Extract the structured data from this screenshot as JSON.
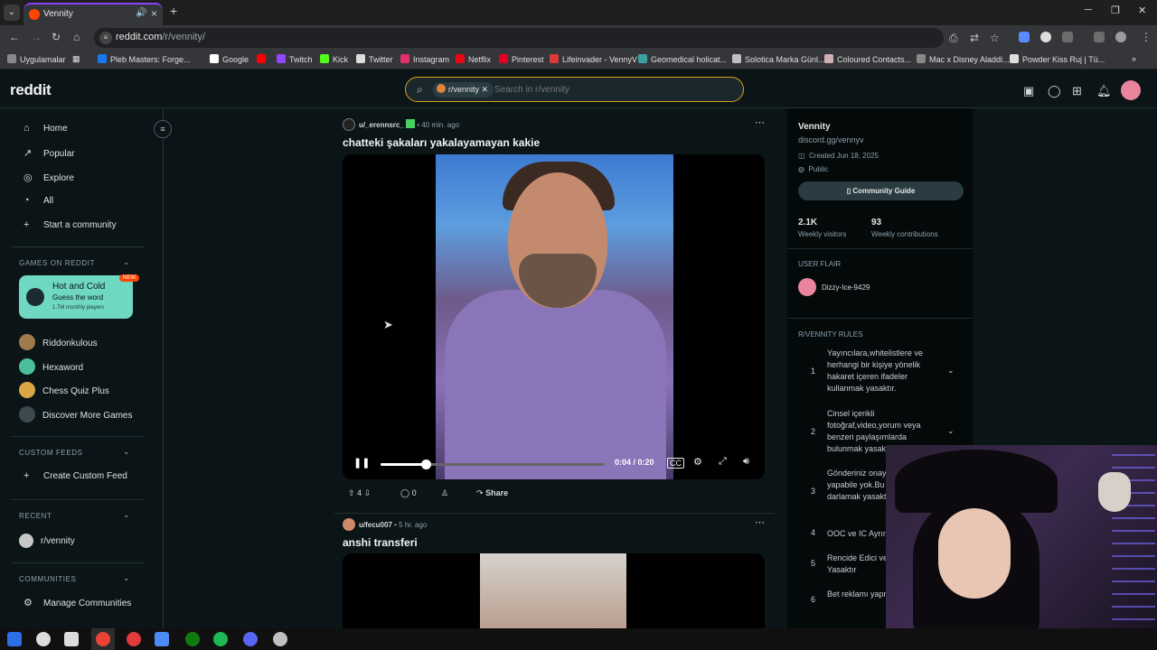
{
  "browser": {
    "tab_title": "Vennity",
    "url_host": "reddit.com",
    "url_path": "/r/vennity/",
    "bookmarks": [
      "Uygulamalar",
      "Pleb Masters: Forge...",
      "Google",
      "Twitch",
      "Kick",
      "Twitter",
      "Instagram",
      "Netflix",
      "Pinterest",
      "Lifeinvader - VennyV",
      "Geomedical holicat...",
      "Solotica Marka Günl...",
      "Coloured Contacts...",
      "Mac x Disney Aladdi...",
      "Powder Kiss Ruj | Tü..."
    ],
    "bookmark_colors": [
      "#888888",
      "#1877f2",
      "#ffffff",
      "#ff0000",
      "#9146ff",
      "#53fc18",
      "#dddddd",
      "#e1306c",
      "#e50914",
      "#e60023",
      "#d93b3b",
      "#3aa0a0",
      "#c0c0c0",
      "#d0b0b0",
      "#888888",
      "#dddddd"
    ]
  },
  "header": {
    "logo": "reddit",
    "search_chip": "r/vennity",
    "search_placeholder": "Search in r/vennity"
  },
  "sidebar": {
    "nav": [
      {
        "icon": "⌂",
        "label": "Home"
      },
      {
        "icon": "↗",
        "label": "Popular"
      },
      {
        "icon": "◎",
        "label": "Explore"
      },
      {
        "icon": "◔",
        "label": "All"
      },
      {
        "icon": "+",
        "label": "Start a community"
      }
    ],
    "games_header": "GAMES ON REDDIT",
    "hot": {
      "title": "Hot and Cold",
      "subtitle": "Guess the word",
      "players": "1.7M monthly players",
      "badge": "NEW"
    },
    "games": [
      {
        "label": "Riddonkulous",
        "color": "#a07a4a"
      },
      {
        "label": "Hexaword",
        "color": "#4bbf9a"
      },
      {
        "label": "Chess Quiz Plus",
        "color": "#d9a845"
      },
      {
        "label": "Discover More Games",
        "color": "#3a4a50"
      }
    ],
    "custom_header": "CUSTOM FEEDS",
    "create_feed": "Create Custom Feed",
    "recent_header": "RECENT",
    "recent_item": "r/vennity",
    "communities_header": "COMMUNITIES",
    "manage": "Manage Communities"
  },
  "posts": [
    {
      "author": "u/_erennsrc_",
      "time": "40 min. ago",
      "title": "chatteki şakaları yakalayamayan kakie",
      "video_time": "0:04 / 0:20",
      "progress": 0.2,
      "votes": "4",
      "comments": "0",
      "share": "Share"
    },
    {
      "author": "u/fecu007",
      "time": "5 hr. ago",
      "title": "anshi transferi"
    }
  ],
  "community": {
    "name": "Vennity",
    "link": "discord.gg/vennyv",
    "created": "Created Jun 18, 2025",
    "visibility": "Public",
    "guide": "Community Guide",
    "visitors": "2.1K",
    "visitors_label": "Weekly visitors",
    "contribs": "93",
    "contribs_label": "Weekly contributions",
    "flair_header": "USER FLAIR",
    "flair_user": "Dizzy-Ice-9429",
    "rules_header": "R/VENNITY RULES",
    "rules": [
      {
        "n": "1",
        "text": "Yayıncılara,whitelistlere ve herhangi bir kişiye yönelik hakaret içeren ifadeler kullanmak yasaktır."
      },
      {
        "n": "2",
        "text": "Cinsel içerikli fotoğraf,video,yorum veya benzeri paylaşımlarda bulunmak yasak"
      },
      {
        "n": "3",
        "text": "Gönderiniz onay konuda yapabile yok.Bu konuda r darlamak yasakt"
      },
      {
        "n": "4",
        "text": "OOC ve IC Ayrım"
      },
      {
        "n": "5",
        "text": "Rencide Edici ve İçerik Yasaktır"
      },
      {
        "n": "6",
        "text": "Bet reklamı yapm yasaktır."
      }
    ]
  },
  "taskbar_colors": [
    "#2b6ee8",
    "#dddddd",
    "#dddddd",
    "#ea4335",
    "#e03c3c",
    "#4c8bf5",
    "#107c10",
    "#1db954",
    "#5865f2",
    "#c0c0c0"
  ]
}
